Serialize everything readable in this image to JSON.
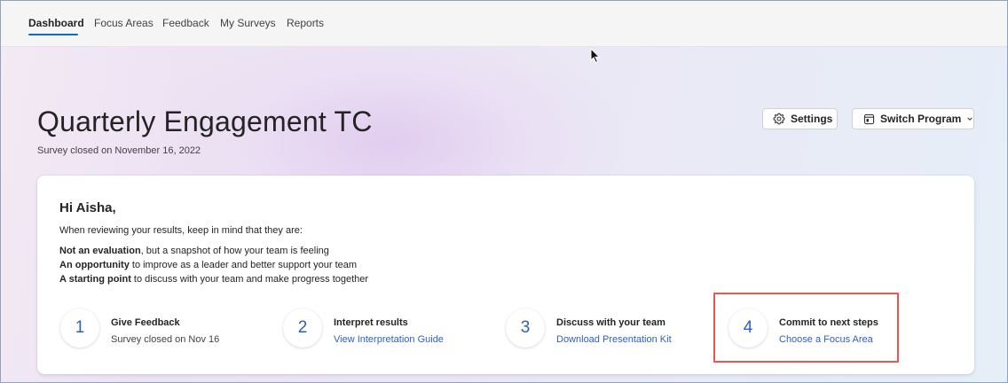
{
  "nav": {
    "tabs": [
      {
        "label": "Dashboard",
        "active": true
      },
      {
        "label": "Focus Areas",
        "active": false
      },
      {
        "label": "Feedback",
        "active": false
      },
      {
        "label": "My Surveys",
        "active": false
      },
      {
        "label": "Reports",
        "active": false
      }
    ]
  },
  "header": {
    "title": "Quarterly Engagement TC",
    "subtitle": "Survey closed on November 16, 2022",
    "settings_label": "Settings",
    "settings_icon": "gear-icon",
    "switch_label": "Switch Program",
    "switch_icon": "program-icon"
  },
  "card": {
    "greeting": "Hi Aisha,",
    "intro": "When reviewing your results, keep in mind that they are:",
    "points": [
      {
        "bold": "Not an evaluation",
        "rest": ", but a snapshot of how your team is feeling"
      },
      {
        "bold": "An opportunity",
        "rest": " to improve as a leader and better support your team"
      },
      {
        "bold": "A starting point",
        "rest": " to discuss with your team and make progress together"
      }
    ],
    "steps": [
      {
        "number": "1",
        "title": "Give Feedback",
        "detail": "Survey closed on Nov 16"
      },
      {
        "number": "2",
        "title": "Interpret results",
        "link": "View Interpretation Guide"
      },
      {
        "number": "3",
        "title": "Discuss with your team",
        "link": "Download Presentation Kit"
      },
      {
        "number": "4",
        "title": "Commit to next steps",
        "link": "Choose a Focus Area"
      }
    ]
  },
  "colors": {
    "accent": "#0f6cbd",
    "link": "#2b5fc9",
    "highlight": "#e25a52"
  }
}
